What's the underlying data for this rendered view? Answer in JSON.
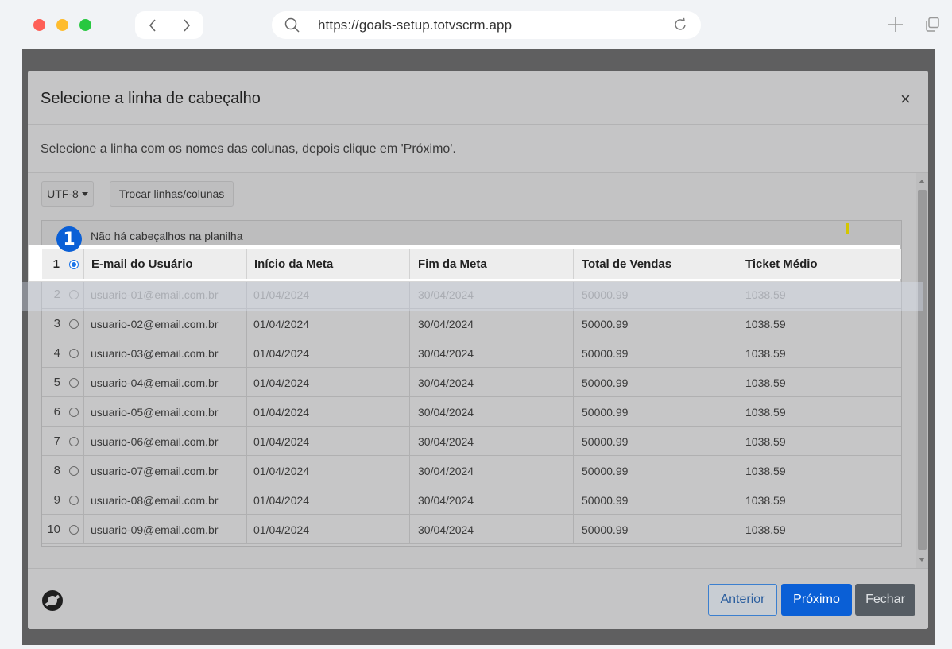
{
  "browser": {
    "url": "https://goals-setup.totvscrm.app"
  },
  "modal": {
    "title": "Selecione a linha de cabeçalho",
    "close_label": "×",
    "description": "Selecione a linha com os nomes das colunas, depois clique em 'Próximo'.",
    "encoding_label": "UTF-8",
    "swap_label": "Trocar linhas/colunas",
    "no_header_label": "Não há cabeçalhos na planilha",
    "step_badge": "1",
    "header_row": {
      "number": "1",
      "columns": [
        "E-mail do Usuário",
        "Início da Meta",
        "Fim da Meta",
        "Total de Vendas",
        "Ticket Médio"
      ]
    },
    "rows": [
      {
        "number": "2",
        "email": "usuario-01@email.com.br",
        "start": "01/04/2024",
        "end": "30/04/2024",
        "total": "50000.99",
        "ticket": "1038.59"
      },
      {
        "number": "3",
        "email": "usuario-02@email.com.br",
        "start": "01/04/2024",
        "end": "30/04/2024",
        "total": "50000.99",
        "ticket": "1038.59"
      },
      {
        "number": "4",
        "email": "usuario-03@email.com.br",
        "start": "01/04/2024",
        "end": "30/04/2024",
        "total": "50000.99",
        "ticket": "1038.59"
      },
      {
        "number": "5",
        "email": "usuario-04@email.com.br",
        "start": "01/04/2024",
        "end": "30/04/2024",
        "total": "50000.99",
        "ticket": "1038.59"
      },
      {
        "number": "6",
        "email": "usuario-05@email.com.br",
        "start": "01/04/2024",
        "end": "30/04/2024",
        "total": "50000.99",
        "ticket": "1038.59"
      },
      {
        "number": "7",
        "email": "usuario-06@email.com.br",
        "start": "01/04/2024",
        "end": "30/04/2024",
        "total": "50000.99",
        "ticket": "1038.59"
      },
      {
        "number": "8",
        "email": "usuario-07@email.com.br",
        "start": "01/04/2024",
        "end": "30/04/2024",
        "total": "50000.99",
        "ticket": "1038.59"
      },
      {
        "number": "9",
        "email": "usuario-08@email.com.br",
        "start": "01/04/2024",
        "end": "30/04/2024",
        "total": "50000.99",
        "ticket": "1038.59"
      },
      {
        "number": "10",
        "email": "usuario-09@email.com.br",
        "start": "01/04/2024",
        "end": "30/04/2024",
        "total": "50000.99",
        "ticket": "1038.59"
      }
    ],
    "footer": {
      "prev_label": "Anterior",
      "next_label": "Próximo",
      "close_label": "Fechar"
    }
  },
  "colors": {
    "accent": "#0a5fd6",
    "overlay": "#5f5f60"
  },
  "icons": {
    "search": "search-icon",
    "reload": "reload-icon",
    "logo": "totvs-logo-icon"
  }
}
